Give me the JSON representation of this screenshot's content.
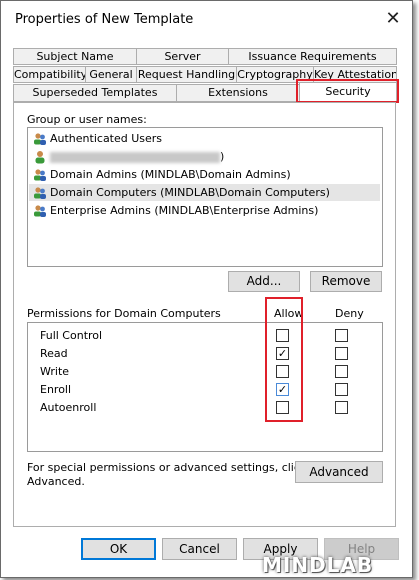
{
  "window": {
    "title": "Properties of New Template",
    "close_glyph": "✕"
  },
  "tabs": {
    "row1": [
      "Subject Name",
      "Server",
      "Issuance Requirements"
    ],
    "row2": [
      "Compatibility",
      "General",
      "Request Handling",
      "Cryptography",
      "Key Attestation"
    ],
    "row3": [
      "Superseded Templates",
      "Extensions",
      "Security"
    ],
    "active": "Security"
  },
  "group_label": "Group or user names:",
  "users": [
    {
      "name": "Authenticated Users",
      "icon": "users-group-icon",
      "selected": false
    },
    {
      "name": ")",
      "icon": "single-user-icon",
      "selected": false,
      "redacted": true
    },
    {
      "name": "Domain Admins (MINDLAB\\Domain Admins)",
      "icon": "users-group-icon",
      "selected": false
    },
    {
      "name": "Domain Computers (MINDLAB\\Domain Computers)",
      "icon": "users-group-icon",
      "selected": true
    },
    {
      "name": "Enterprise Admins (MINDLAB\\Enterprise Admins)",
      "icon": "users-group-icon",
      "selected": false
    }
  ],
  "buttons": {
    "add": "Add...",
    "remove": "Remove",
    "advanced": "Advanced",
    "ok": "OK",
    "cancel": "Cancel",
    "apply": "Apply",
    "help": "Help"
  },
  "permissions": {
    "label": "Permissions for Domain Computers",
    "allow_header": "Allow",
    "deny_header": "Deny",
    "rows": [
      {
        "name": "Full Control",
        "allow": false,
        "deny": false
      },
      {
        "name": "Read",
        "allow": true,
        "deny": false
      },
      {
        "name": "Write",
        "allow": false,
        "deny": false
      },
      {
        "name": "Enroll",
        "allow": true,
        "deny": false
      },
      {
        "name": "Autoenroll",
        "allow": false,
        "deny": false
      }
    ]
  },
  "special_note_line1": "For special permissions or advanced settings, click",
  "special_note_line2": "Advanced.",
  "watermark": "MINDLAB",
  "colors": {
    "highlight_box": "#e0202a",
    "selected_row": "#e5e5e5",
    "default_button_border": "#0078d7"
  }
}
